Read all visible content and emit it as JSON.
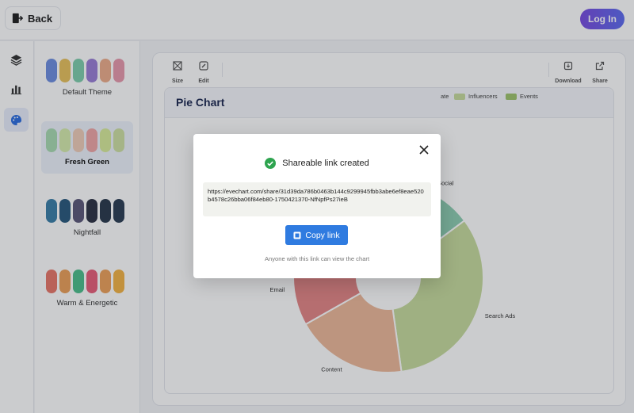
{
  "topbar": {
    "back_label": "Back",
    "login_label": "Log In"
  },
  "rail": {
    "items": [
      "layers-icon",
      "bar-chart-icon",
      "palette-icon"
    ],
    "active": "palette-icon"
  },
  "themes": [
    {
      "name": "Default Theme",
      "selected": false,
      "colors": [
        "#6f8fe0",
        "#e8c25e",
        "#7fcfae",
        "#9a7fd6",
        "#eeae8c",
        "#e89aae"
      ]
    },
    {
      "name": "Fresh Green",
      "selected": true,
      "colors": [
        "#a9dcb2",
        "#d6ecae",
        "#f0cdb9",
        "#f0a7a7",
        "#d9ec9c",
        "#cfe1a4"
      ]
    },
    {
      "name": "Nightfall",
      "selected": false,
      "colors": [
        "#3c7fa8",
        "#2b5a7e",
        "#5d597a",
        "#2f3446",
        "#2b3a4e",
        "#2e3f55"
      ]
    },
    {
      "name": "Warm & Energetic",
      "selected": false,
      "colors": [
        "#e8786a",
        "#eca15a",
        "#4dbf8c",
        "#e85f7a",
        "#eea25b",
        "#f4b446"
      ]
    }
  ],
  "toolbar": {
    "size_label": "Size",
    "edit_label": "Edit",
    "download_label": "Download",
    "share_label": "Share"
  },
  "chart": {
    "title": "Pie Chart"
  },
  "chart_data": {
    "type": "pie",
    "title": "Pie Chart",
    "donut": true,
    "legend_visible": [
      "Influencers",
      "Events"
    ],
    "legend_partial_text": "ate",
    "slices": [
      {
        "label": "Social",
        "value": 14,
        "color": "#8fcfb3"
      },
      {
        "label": "Search Ads",
        "value": 33,
        "color": "#c7dc9e"
      },
      {
        "label": "Content",
        "value": 19,
        "color": "#eeb99a"
      },
      {
        "label": "Email",
        "value": 12,
        "color": "#e48787"
      },
      {
        "label": "Influencers",
        "value": 7,
        "color": "#d6d86e"
      },
      {
        "label": "",
        "value": 15,
        "color": "#bfbfbf"
      }
    ],
    "colors": {
      "Influencers": "#c7dc9e",
      "Events": "#9fc46e"
    }
  },
  "modal": {
    "status_text": "Shareable link created",
    "link": "https://evechart.com/share/31d39da786b0463b144c9299945fbb3abe6ef8eae520b4578c26bba06f84eb80-1750421370-NfNpfPs27ieB",
    "copy_label": "Copy link",
    "note": "Anyone with this link can view the chart"
  }
}
